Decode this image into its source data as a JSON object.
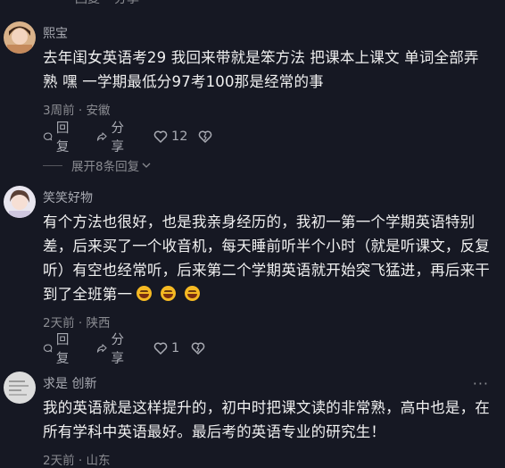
{
  "top_partial": {
    "reply_label": "回复",
    "share_label": "分享"
  },
  "comments": [
    {
      "username": "熙宝",
      "text": "去年闺女英语考29 我回来带就是笨方法 把课本上课文 单词全部弄熟 嘿 一学期最低分97考100那是经常的事",
      "time": "3周前",
      "location": "安徽",
      "reply_label": "回复",
      "share_label": "分享",
      "likes": "12",
      "expand_label": "展开8条回复"
    },
    {
      "username": "笑笑好物",
      "text": "有个方法也很好，也是我亲身经历的，我初一第一个学期英语特别差，后来买了一个收音机，每天睡前听半个小时（就是听课文，反复听）有空也经常听，后来第二个学期英语就开始突飞猛进，再后来干到了全班第一",
      "time": "2天前",
      "location": "陕西",
      "reply_label": "回复",
      "share_label": "分享",
      "likes": "1"
    },
    {
      "username": "求是 创新",
      "text": "我的英语就是这样提升的，初中时把课文读的非常熟，高中也是，在所有学科中英语最好。最后考的英语专业的研究生！",
      "time": "2天前",
      "location": "山东"
    }
  ],
  "meta_separator": "·",
  "icons": [
    "comment-bubble-icon",
    "share-arrow-icon",
    "heart-icon",
    "dislike-heart-icon",
    "chevron-down-icon",
    "more-dots-icon"
  ],
  "colors": {
    "background": "#161823",
    "text": "#f0f0f0",
    "secondary": "#8a8b91",
    "emoji": "#f5b923"
  }
}
